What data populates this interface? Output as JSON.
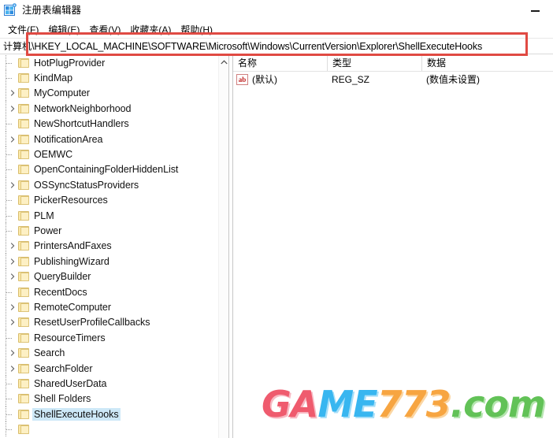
{
  "window": {
    "title": "注册表编辑器",
    "icon": "registry-grid-icon",
    "buttons": [
      {
        "name": "minimize-button",
        "glyph": "minimize"
      }
    ]
  },
  "menu": {
    "items": [
      {
        "label": "文件(F)",
        "name": "menu-file"
      },
      {
        "label": "编辑(E)",
        "name": "menu-edit"
      },
      {
        "label": "查看(V)",
        "name": "menu-view"
      },
      {
        "label": "收藏夹(A)",
        "name": "menu-favorites"
      },
      {
        "label": "帮助(H)",
        "name": "menu-help"
      }
    ]
  },
  "address": {
    "prefix": "计算机",
    "path": "\\HKEY_LOCAL_MACHINE\\SOFTWARE\\Microsoft\\Windows\\CurrentVersion\\Explorer\\ShellExecuteHooks"
  },
  "tree": {
    "scroll_up_icon": "chevron-up-icon",
    "items": [
      {
        "label": "HotPlugProvider",
        "expandable": false,
        "selected": false
      },
      {
        "label": "KindMap",
        "expandable": false,
        "selected": false
      },
      {
        "label": "MyComputer",
        "expandable": true,
        "selected": false
      },
      {
        "label": "NetworkNeighborhood",
        "expandable": true,
        "selected": false
      },
      {
        "label": "NewShortcutHandlers",
        "expandable": false,
        "selected": false
      },
      {
        "label": "NotificationArea",
        "expandable": true,
        "selected": false
      },
      {
        "label": "OEMWC",
        "expandable": false,
        "selected": false
      },
      {
        "label": "OpenContainingFolderHiddenList",
        "expandable": false,
        "selected": false
      },
      {
        "label": "OSSyncStatusProviders",
        "expandable": true,
        "selected": false
      },
      {
        "label": "PickerResources",
        "expandable": false,
        "selected": false
      },
      {
        "label": "PLM",
        "expandable": false,
        "selected": false
      },
      {
        "label": "Power",
        "expandable": false,
        "selected": false
      },
      {
        "label": "PrintersAndFaxes",
        "expandable": true,
        "selected": false
      },
      {
        "label": "PublishingWizard",
        "expandable": true,
        "selected": false
      },
      {
        "label": "QueryBuilder",
        "expandable": true,
        "selected": false
      },
      {
        "label": "RecentDocs",
        "expandable": false,
        "selected": false
      },
      {
        "label": "RemoteComputer",
        "expandable": true,
        "selected": false
      },
      {
        "label": "ResetUserProfileCallbacks",
        "expandable": true,
        "selected": false
      },
      {
        "label": "ResourceTimers",
        "expandable": false,
        "selected": false
      },
      {
        "label": "Search",
        "expandable": true,
        "selected": false
      },
      {
        "label": "SearchFolder",
        "expandable": true,
        "selected": false
      },
      {
        "label": "SharedUserData",
        "expandable": false,
        "selected": false
      },
      {
        "label": "Shell Folders",
        "expandable": false,
        "selected": false
      },
      {
        "label": "ShellExecuteHooks",
        "expandable": false,
        "selected": true
      },
      {
        "label": "",
        "expandable": false,
        "selected": false
      }
    ]
  },
  "values": {
    "columns": [
      {
        "label": "名称"
      },
      {
        "label": "类型"
      },
      {
        "label": "数据"
      }
    ],
    "rows": [
      {
        "icon": "string-value-ab-icon",
        "icon_text": "ab",
        "name": "(默认)",
        "type": "REG_SZ",
        "data": "(数值未设置)"
      }
    ]
  },
  "annotation": {
    "color": "#e04a43",
    "name": "address-bar-highlight"
  },
  "watermark": {
    "segments": [
      {
        "text": "G",
        "class": "wm-g",
        "color": "#ef5b6e"
      },
      {
        "text": "A",
        "class": "wm-a",
        "color": "#ef5b6e"
      },
      {
        "text": "ME",
        "class": "wm-me",
        "color": "#38b6f0"
      },
      {
        "text": "77",
        "class": "wm-77",
        "color": "#f7a541"
      },
      {
        "text": "3",
        "class": "wm-3",
        "color": "#f7a541"
      },
      {
        "text": ".",
        "class": "wm-dot",
        "color": "#62c257"
      },
      {
        "text": "com",
        "class": "wm-com",
        "color": "#62c257"
      }
    ]
  }
}
